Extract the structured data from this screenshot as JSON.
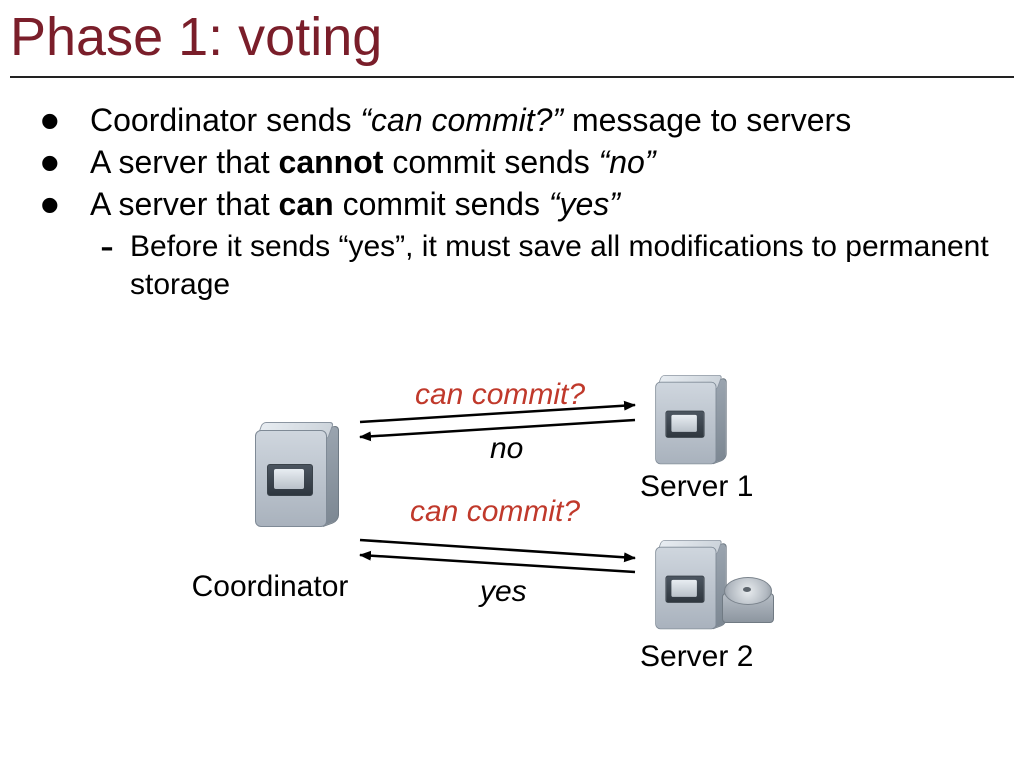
{
  "title": "Phase 1: voting",
  "bullets": {
    "b1_pre": "Coordinator sends ",
    "b1_q": "“can commit?”",
    "b1_post": " message to servers",
    "b2_pre": "A server that ",
    "b2_bold": "cannot",
    "b2_mid": " commit sends ",
    "b2_q": "“no”",
    "b3_pre": "A server that ",
    "b3_bold": "can",
    "b3_mid": " commit sends ",
    "b3_q": "“yes”",
    "sub1": "Before it sends “yes”, it must save all modifications to permanent storage"
  },
  "diagram": {
    "coordinator": "Coordinator",
    "server1": "Server 1",
    "server2": "Server 2",
    "can_commit": "can commit?",
    "no": "no",
    "yes": "yes"
  },
  "colors": {
    "title": "#7a1e2a",
    "msg_red": "#c0392b"
  }
}
